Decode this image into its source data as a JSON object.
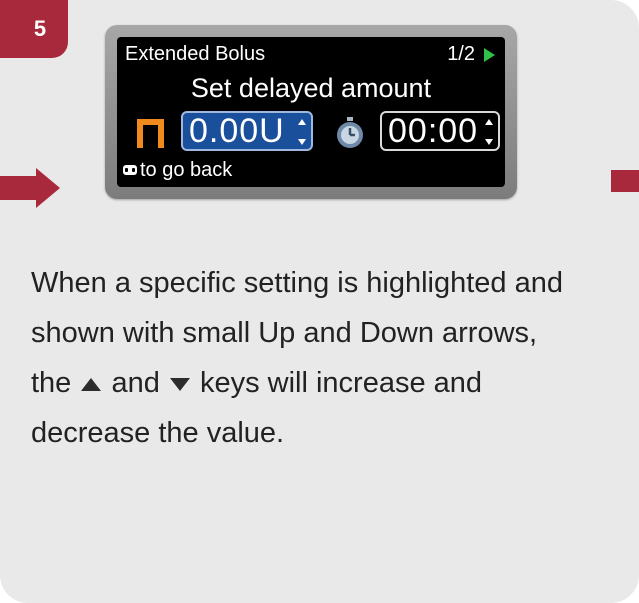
{
  "step": {
    "number": "5"
  },
  "colors": {
    "accent": "#a9293c",
    "panel": "#e9e9e9",
    "screen_bg": "#000000",
    "selected_field": "#1a4f9c",
    "bolus_icon": "#f08a1c",
    "page_arrow": "#2ec24a"
  },
  "screen": {
    "title": "Extended Bolus",
    "page": "1/2",
    "page_icon": "play-triangle-icon",
    "heading": "Set delayed amount",
    "amount": "0.00U",
    "time": "00:00",
    "back_hint": "to go back",
    "icons": [
      "square-wave-bolus-icon",
      "up-down-arrows-icon",
      "timer-icon",
      "back-button-icon"
    ]
  },
  "description": {
    "line1": "When a specific setting is highlighted and",
    "line2": "shown with small Up and Down arrows,",
    "line3_before": "the",
    "line3_middle": "and",
    "line3_after": "keys will increase and",
    "line4": "decrease the value."
  }
}
